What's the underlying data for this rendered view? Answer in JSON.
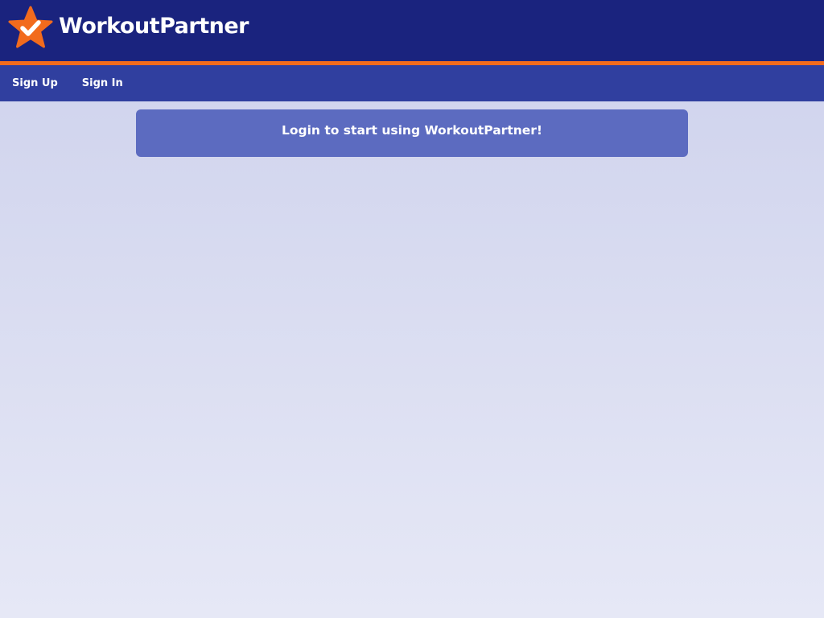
{
  "app": {
    "brand_name": "WorkoutPartner",
    "logo_icon": "star-check-icon"
  },
  "nav": {
    "items": [
      {
        "label": "Sign Up"
      },
      {
        "label": "Sign In"
      }
    ]
  },
  "main": {
    "banner_text": "Login to start using WorkoutPartner!"
  },
  "colors": {
    "header_bg": "#1a237e",
    "accent": "#f26b1d",
    "nav_bg": "#303f9f",
    "banner_bg": "#5c6bc0"
  }
}
